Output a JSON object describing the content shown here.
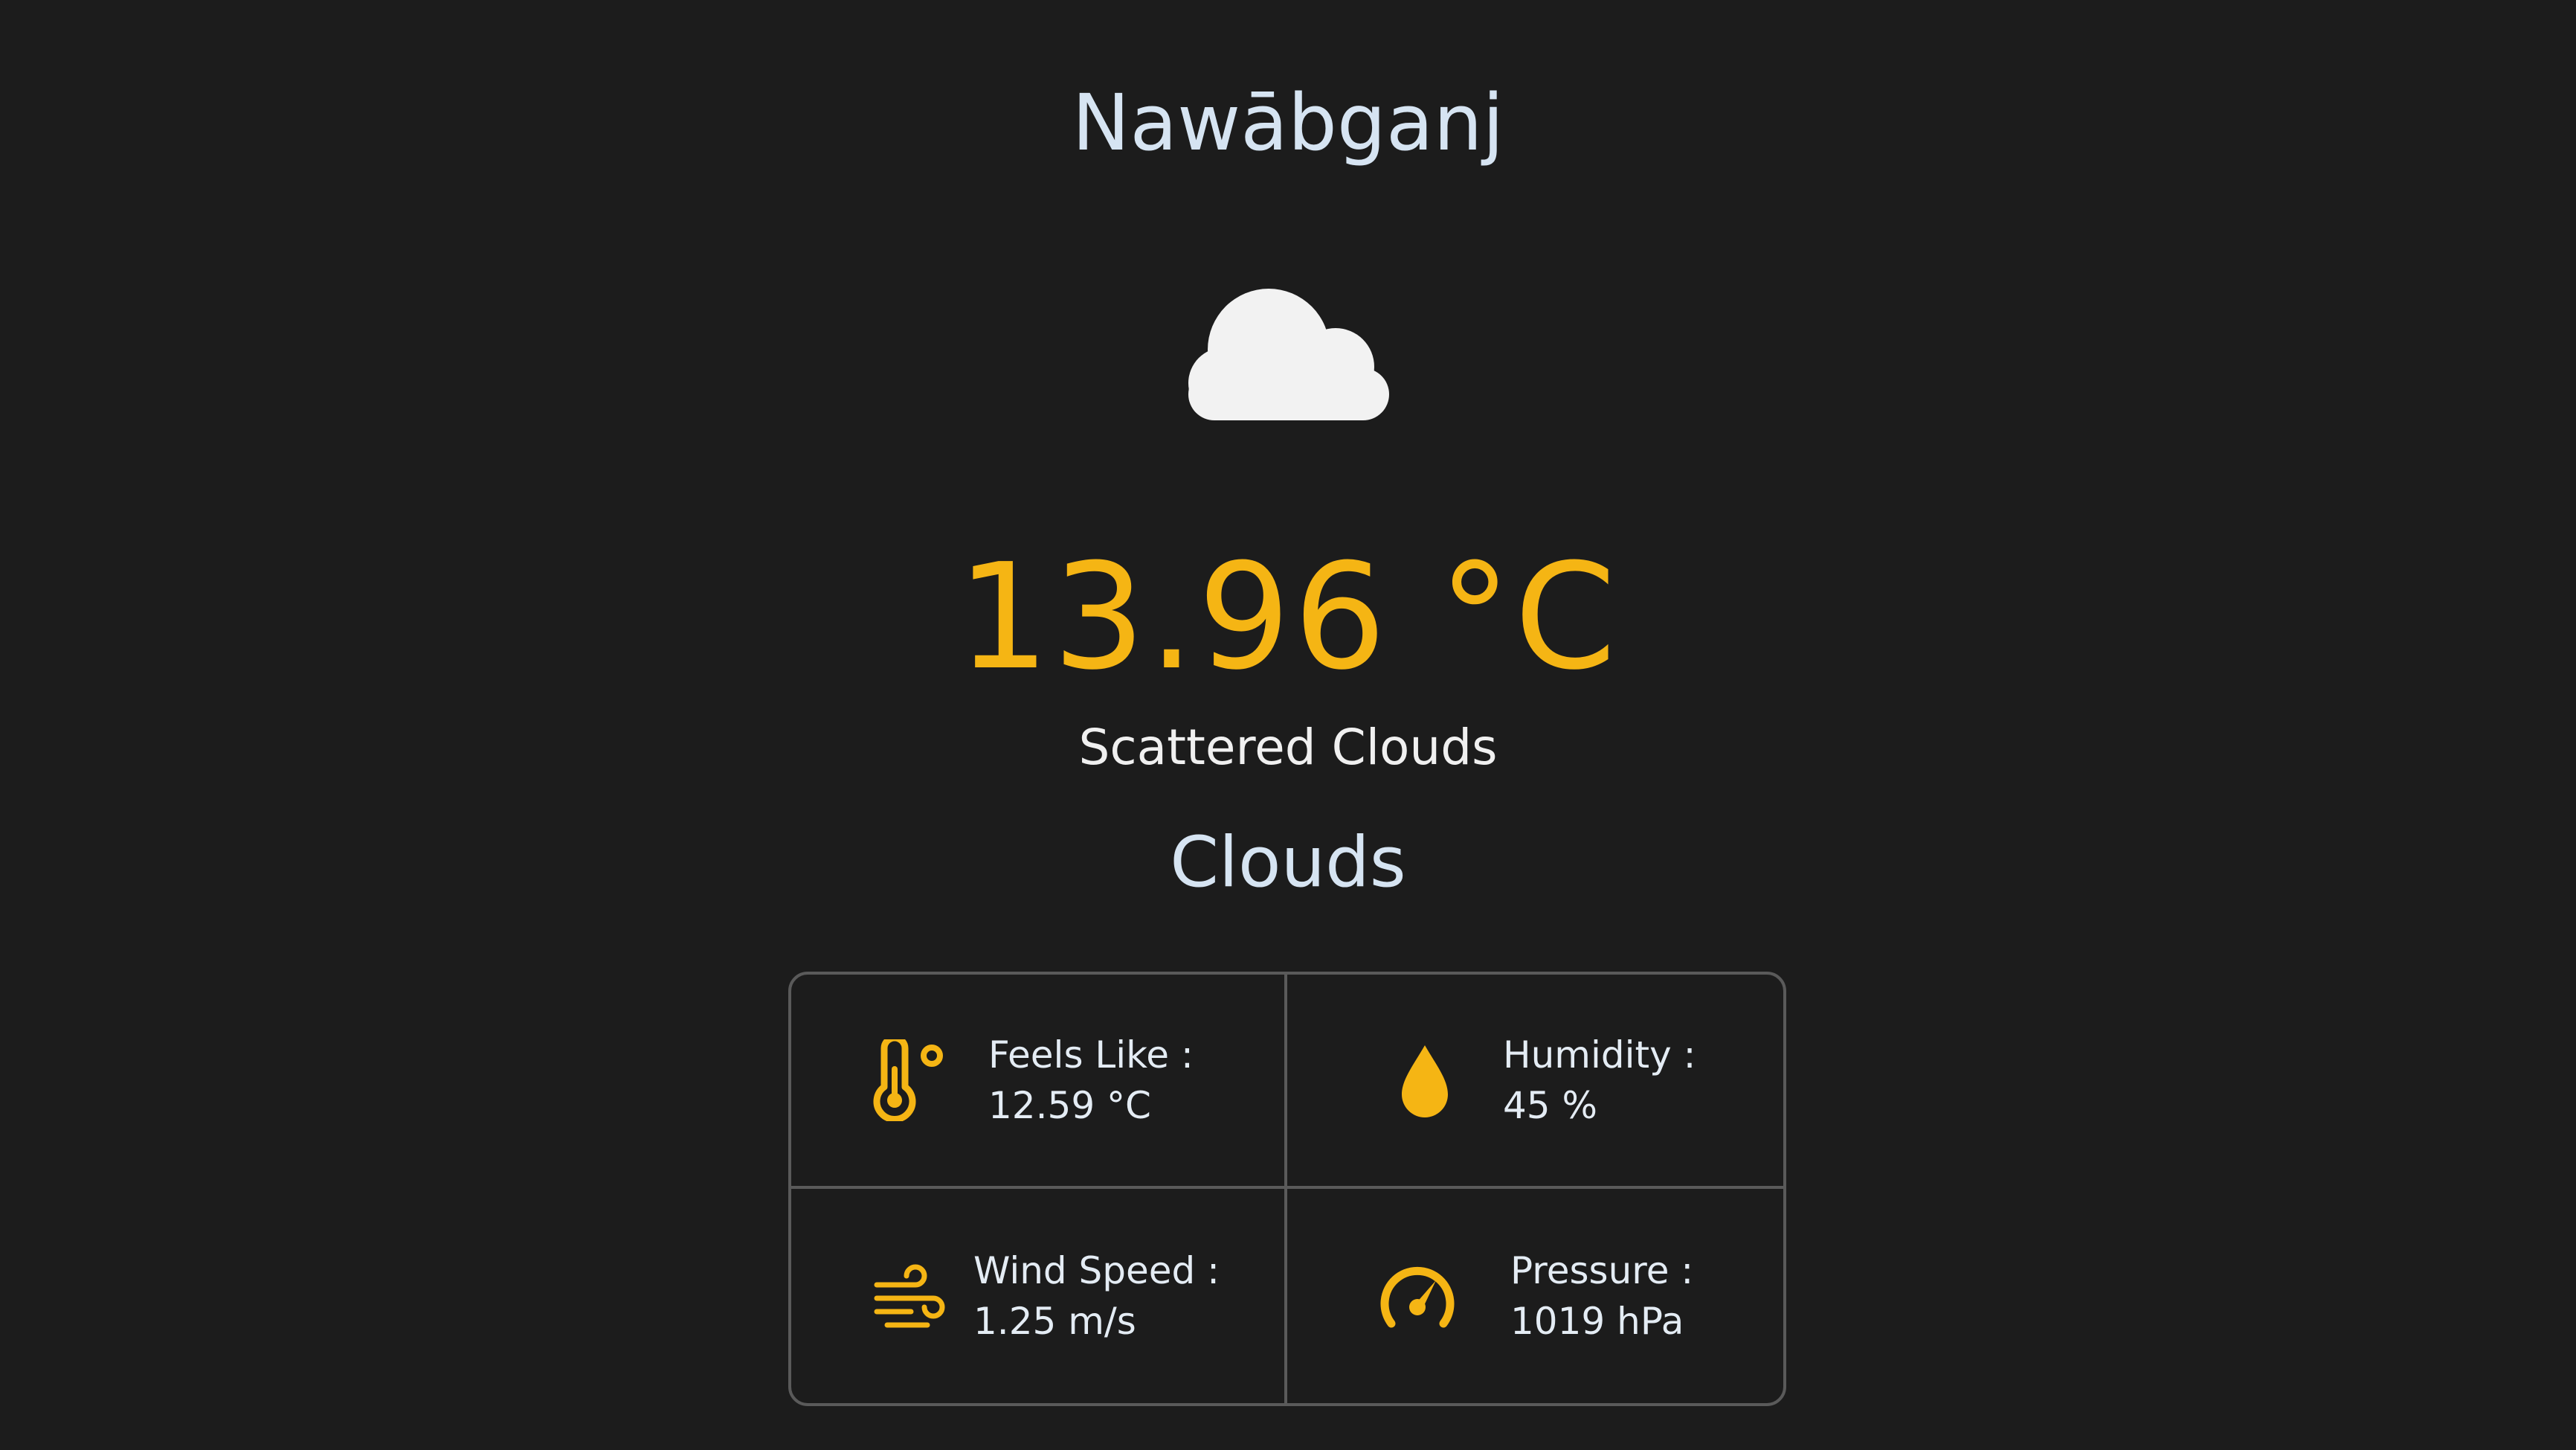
{
  "city": "Nawābganj",
  "condition_icon": "cloud-icon",
  "temperature": "13.96 °C",
  "description": "Scattered Clouds",
  "main": "Clouds",
  "details": [
    {
      "icon": "thermometer-icon",
      "label": "Feels Like :",
      "value": "12.59 °C"
    },
    {
      "icon": "water-drop-icon",
      "label": "Humidity :",
      "value": "45 %"
    },
    {
      "icon": "wind-icon",
      "label": "Wind Speed :",
      "value": "1.25 m/s"
    },
    {
      "icon": "gauge-icon",
      "label": "Pressure :",
      "value": "1019 hPa"
    }
  ],
  "colors": {
    "background": "#1c1c1c",
    "accent": "#f5b514",
    "text": "#dde6f0",
    "border": "#5a5a5a"
  }
}
